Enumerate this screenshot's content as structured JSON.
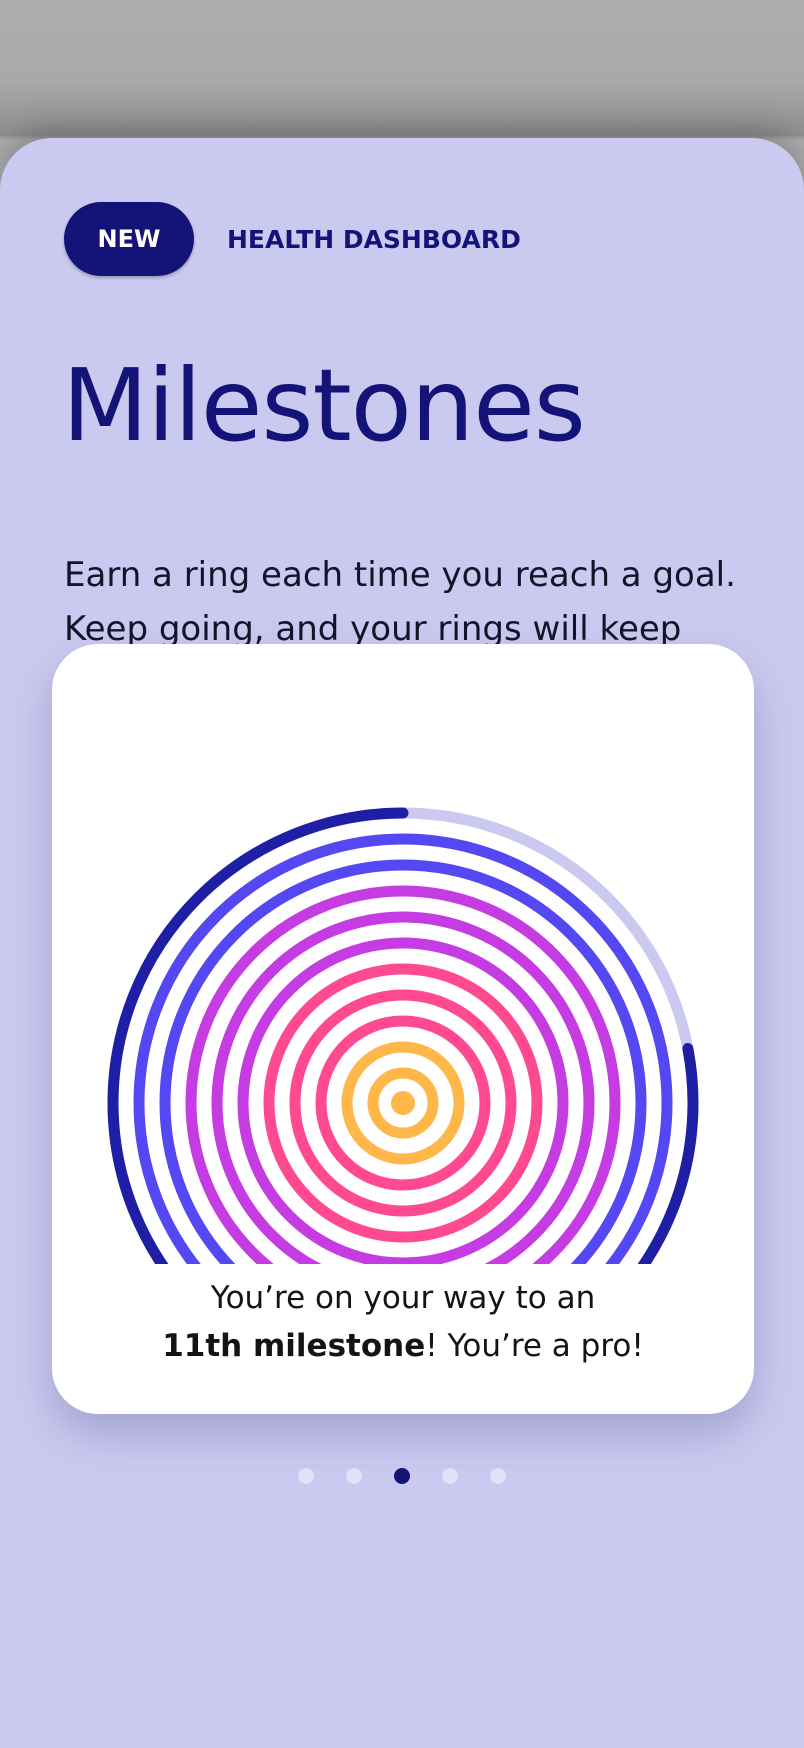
{
  "header": {
    "badge": "NEW",
    "category": "HEALTH DASHBOARD"
  },
  "title": "Milestones",
  "description": "Earn a ring each time you reach a goal. Keep going, and your rings will keep growing.",
  "milestone_card": {
    "caption_line1": "You’re on your way to an",
    "caption_emphasis": "11th milestone",
    "caption_rest": "! You’re a pro!",
    "completed_rings": 10,
    "current_ring_progress": 0.78,
    "ring_colors": [
      "#ffb74a",
      "#ffb74a",
      "#ff4a92",
      "#ff4a92",
      "#ff4a92",
      "#c43ce2",
      "#c43ce2",
      "#c43ce2",
      "#5448f2",
      "#5448f2"
    ],
    "current_ring_color": "#1f1fa6",
    "current_ring_track_color": "#cbc9ef"
  },
  "pager": {
    "count": 5,
    "active_index": 2
  },
  "colors": {
    "brand": "#141478",
    "background": "#cac9ef",
    "card": "#ffffff"
  }
}
